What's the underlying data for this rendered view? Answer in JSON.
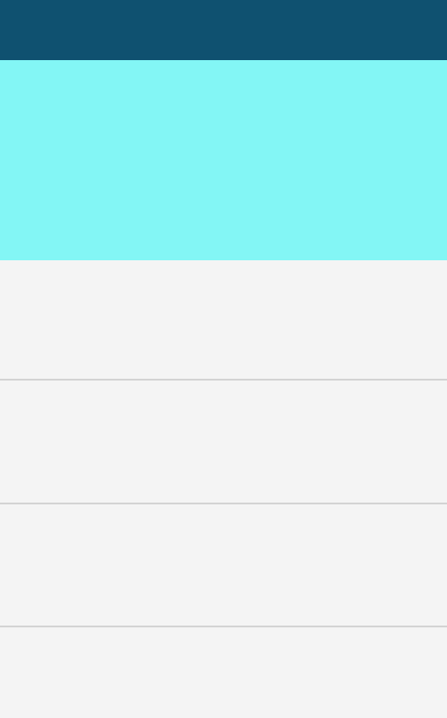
{
  "colors": {
    "app_bar": "#0f5170",
    "hero": "#83f6f5",
    "background": "#f4f4f4",
    "divider": "#d3d3d3"
  },
  "list": {
    "rows": [
      {
        "label": ""
      },
      {
        "label": ""
      },
      {
        "label": ""
      },
      {
        "label": ""
      }
    ]
  }
}
